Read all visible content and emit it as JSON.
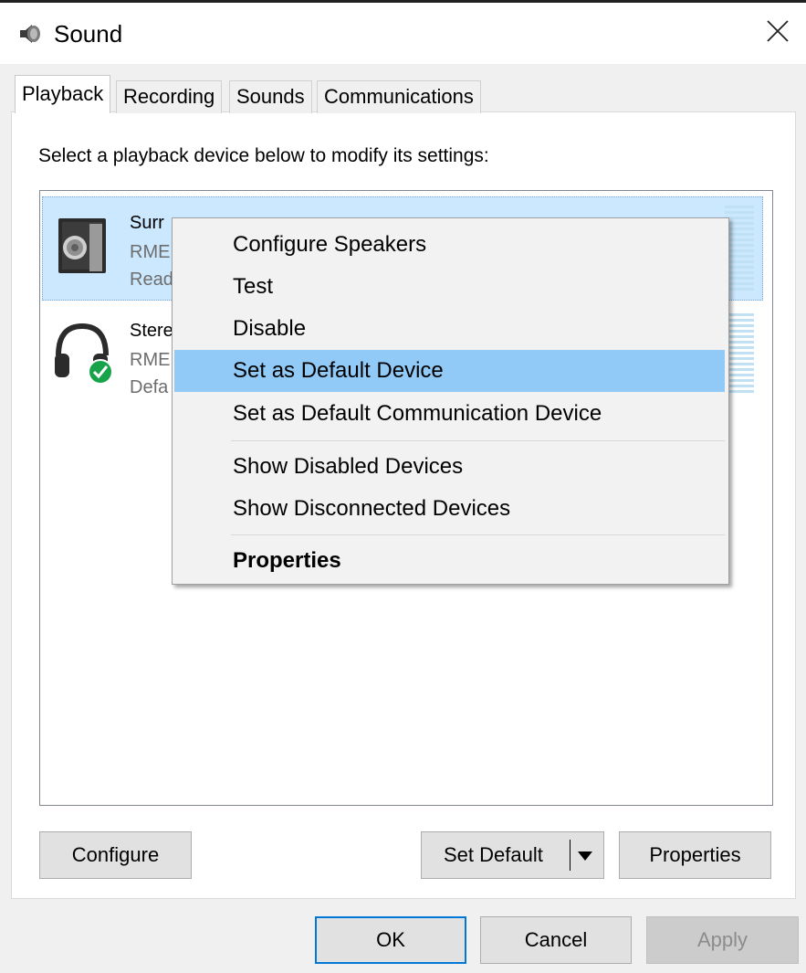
{
  "window": {
    "title": "Sound",
    "close_icon": "close-icon"
  },
  "tabs": [
    {
      "label": "Playback",
      "active": true
    },
    {
      "label": "Recording"
    },
    {
      "label": "Sounds"
    },
    {
      "label": "Communications"
    }
  ],
  "instruction": "Select a playback device below to modify its settings:",
  "devices": [
    {
      "name": "Surr",
      "sub1": "RME",
      "sub2": "Read",
      "icon": "speaker-icon",
      "selected": true
    },
    {
      "name": "Stere",
      "sub1": "RME",
      "sub2": "Defa",
      "icon": "headphones-default-icon"
    }
  ],
  "context_menu": {
    "items": [
      "Configure Speakers",
      "Test",
      "Disable",
      "Set as Default Device",
      "Set as Default Communication Device",
      "Show Disabled Devices",
      "Show Disconnected Devices",
      "Properties"
    ],
    "highlighted": "Set as Default Device"
  },
  "buttons": {
    "configure": "Configure",
    "set_default": "Set Default",
    "properties": "Properties",
    "ok": "OK",
    "cancel": "Cancel",
    "apply": "Apply"
  },
  "colors": {
    "selection": "#cce8ff",
    "menu_highlight": "#91c9f7",
    "accent": "#0078d7",
    "default_badge": "#16a34a"
  }
}
